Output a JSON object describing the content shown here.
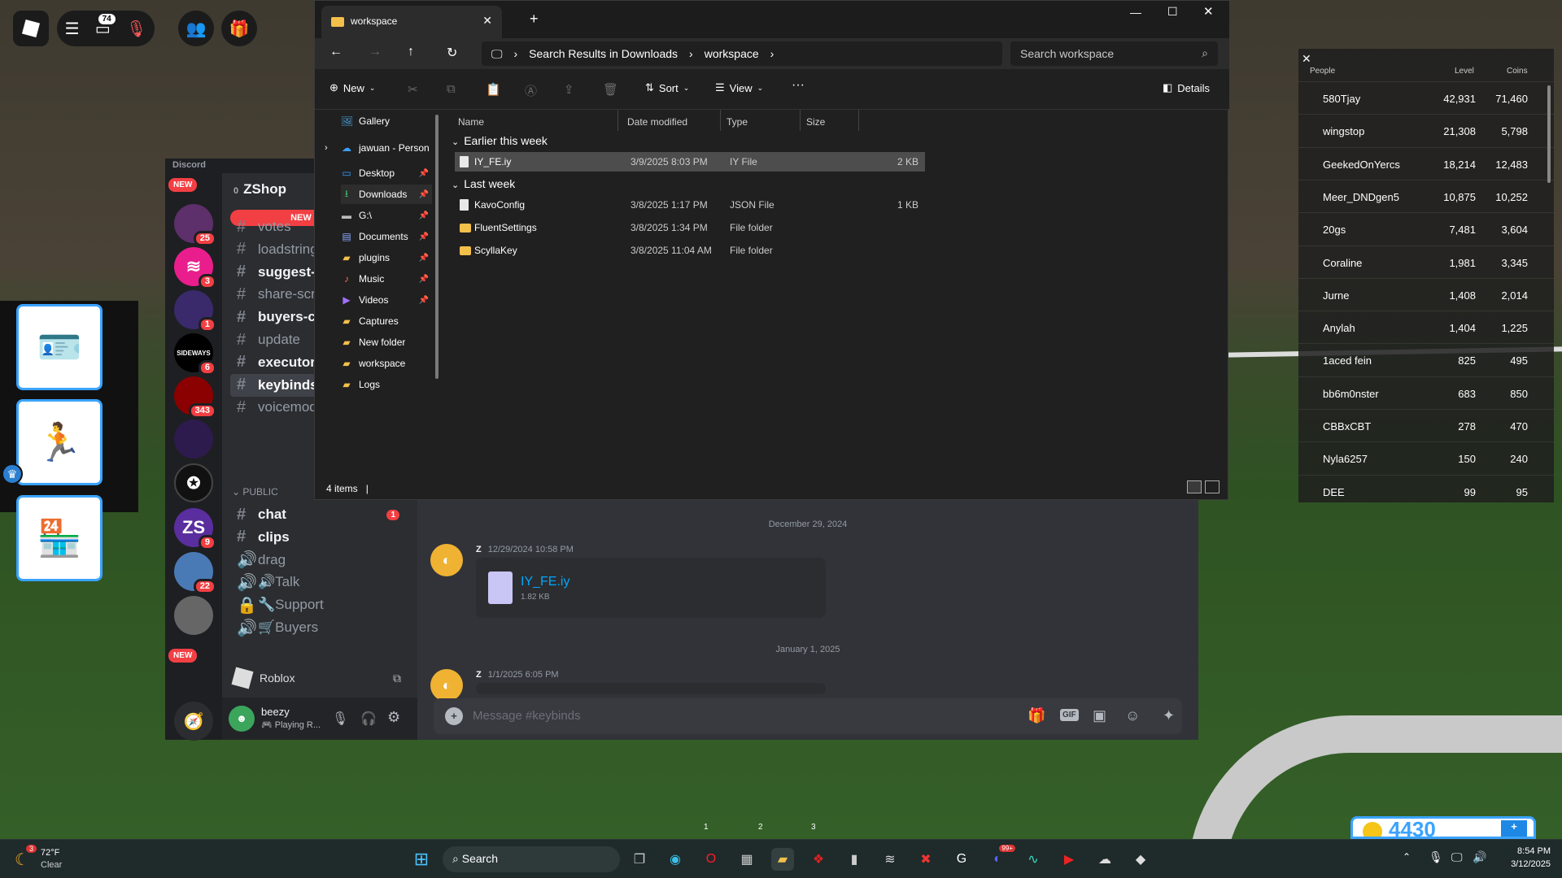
{
  "roblox": {
    "chat_badge": "74",
    "coins": "4430"
  },
  "discord": {
    "app_name": "Discord",
    "server_name": "ZShop",
    "server_prefix": "0",
    "new_label": "NEW",
    "new_msgs_label": "NEW M",
    "channels_top": [
      {
        "name": "votes",
        "bold": false
      },
      {
        "name": "loadstring",
        "bold": false
      },
      {
        "name": "suggest-e",
        "bold": true
      },
      {
        "name": "share-scri",
        "bold": false
      },
      {
        "name": "buyers-ch",
        "bold": true
      },
      {
        "name": "update",
        "bold": false
      },
      {
        "name": "executors",
        "bold": true
      },
      {
        "name": "keybinds",
        "bold": true
      },
      {
        "name": "voicemod",
        "bold": false
      }
    ],
    "category_public": "PUBLIC",
    "channels_public": [
      {
        "icon": "#",
        "name": "chat",
        "badge": "1"
      },
      {
        "icon": "#",
        "name": "clips"
      },
      {
        "icon": "🔊",
        "name": "drag"
      },
      {
        "icon": "🔊",
        "name": "🔊Talk"
      },
      {
        "icon": "🔒",
        "name": "🔧Support"
      },
      {
        "icon": "🔊",
        "name": "🛒Buyers"
      }
    ],
    "server_badges": [
      "25",
      "3",
      "1",
      "6",
      "343",
      "",
      "",
      "9",
      "22"
    ],
    "sideways_label": "SIDEWAYS",
    "roblox_activity": "Roblox",
    "user": {
      "name": "beezy",
      "status": "Playing R..."
    },
    "date_divider_1": "December 29, 2024",
    "date_divider_2": "January 1, 2025",
    "messages": [
      {
        "author": "Z",
        "time": "12/29/2024 10:58 PM",
        "file": "IY_FE.iy",
        "size": "1.82 KB"
      },
      {
        "author": "Z",
        "time": "1/1/2025 6:05 PM"
      }
    ],
    "input_placeholder": "Message #keybinds"
  },
  "explorer": {
    "tab_title": "workspace",
    "breadcrumb": [
      "Search Results in Downloads",
      "workspace"
    ],
    "search_placeholder": "Search workspace",
    "cmd": {
      "new": "New",
      "sort": "Sort",
      "view": "View",
      "details": "Details",
      "more": "···"
    },
    "nav": [
      {
        "label": "Gallery",
        "icon": "🖼",
        "color": "#4aa3df"
      },
      {
        "label": "jawuan - Person",
        "icon": "☁",
        "color": "#3aa0ff",
        "expand": true
      },
      {
        "label": "Desktop",
        "icon": "▭",
        "color": "#3aa0ff",
        "pin": true
      },
      {
        "label": "Downloads",
        "icon": "⭳",
        "color": "#3cc46a",
        "pin": true,
        "sel": true
      },
      {
        "label": "G:\\",
        "icon": "▬",
        "color": "#bbb",
        "pin": true
      },
      {
        "label": "Documents",
        "icon": "▤",
        "color": "#8aa8ff",
        "pin": true
      },
      {
        "label": "plugins",
        "icon": "▰",
        "color": "#f3c04a",
        "pin": true
      },
      {
        "label": "Music",
        "icon": "♪",
        "color": "#ff6b5a",
        "pin": true
      },
      {
        "label": "Videos",
        "icon": "▶",
        "color": "#a070ff",
        "pin": true
      },
      {
        "label": "Captures",
        "icon": "▰",
        "color": "#f3c04a"
      },
      {
        "label": "New folder",
        "icon": "▰",
        "color": "#f3c04a"
      },
      {
        "label": "workspace",
        "icon": "▰",
        "color": "#f3c04a"
      },
      {
        "label": "Logs",
        "icon": "▰",
        "color": "#f3c04a"
      }
    ],
    "columns": [
      "Name",
      "Date modified",
      "Type",
      "Size"
    ],
    "groups": [
      {
        "title": "Earlier this week",
        "rows": [
          {
            "name": "IY_FE.iy",
            "date": "3/9/2025 8:03 PM",
            "type": "IY File",
            "size": "2 KB",
            "kind": "file",
            "sel": true
          }
        ]
      },
      {
        "title": "Last week",
        "rows": [
          {
            "name": "KavoConfig",
            "date": "3/8/2025 1:17 PM",
            "type": "JSON File",
            "size": "1 KB",
            "kind": "file"
          },
          {
            "name": "FluentSettings",
            "date": "3/8/2025 1:34 PM",
            "type": "File folder",
            "size": "",
            "kind": "folder"
          },
          {
            "name": "ScyllaKey",
            "date": "3/8/2025 11:04 AM",
            "type": "File folder",
            "size": "",
            "kind": "folder"
          }
        ]
      }
    ],
    "status": "4 items"
  },
  "leaderboard": {
    "headers": [
      "People",
      "Level",
      "Coins"
    ],
    "rows": [
      [
        "580Tjay",
        "42,931",
        "71,460"
      ],
      [
        "wingstop",
        "21,308",
        "5,798"
      ],
      [
        "GeekedOnYercs",
        "18,214",
        "12,483"
      ],
      [
        "Meer_DNDgen5",
        "10,875",
        "10,252"
      ],
      [
        "20gs",
        "7,481",
        "3,604"
      ],
      [
        "Coraline",
        "1,981",
        "3,345"
      ],
      [
        "Jurne",
        "1,408",
        "2,014"
      ],
      [
        "Anylah",
        "1,404",
        "1,225"
      ],
      [
        "1aced fein",
        "825",
        "495"
      ],
      [
        "bb6m0nster",
        "683",
        "850"
      ],
      [
        "CBBxCBT",
        "278",
        "470"
      ],
      [
        "Nyla6257",
        "150",
        "240"
      ],
      [
        "DEE",
        "99",
        "95"
      ]
    ]
  },
  "hotbar": [
    "1",
    "2",
    "3"
  ],
  "taskbar": {
    "weather_temp": "72°F",
    "weather_desc": "Clear",
    "weather_badge": "3",
    "search": "Search",
    "time": "8:54 PM",
    "date": "3/12/2025",
    "discord_badge": "99+"
  }
}
